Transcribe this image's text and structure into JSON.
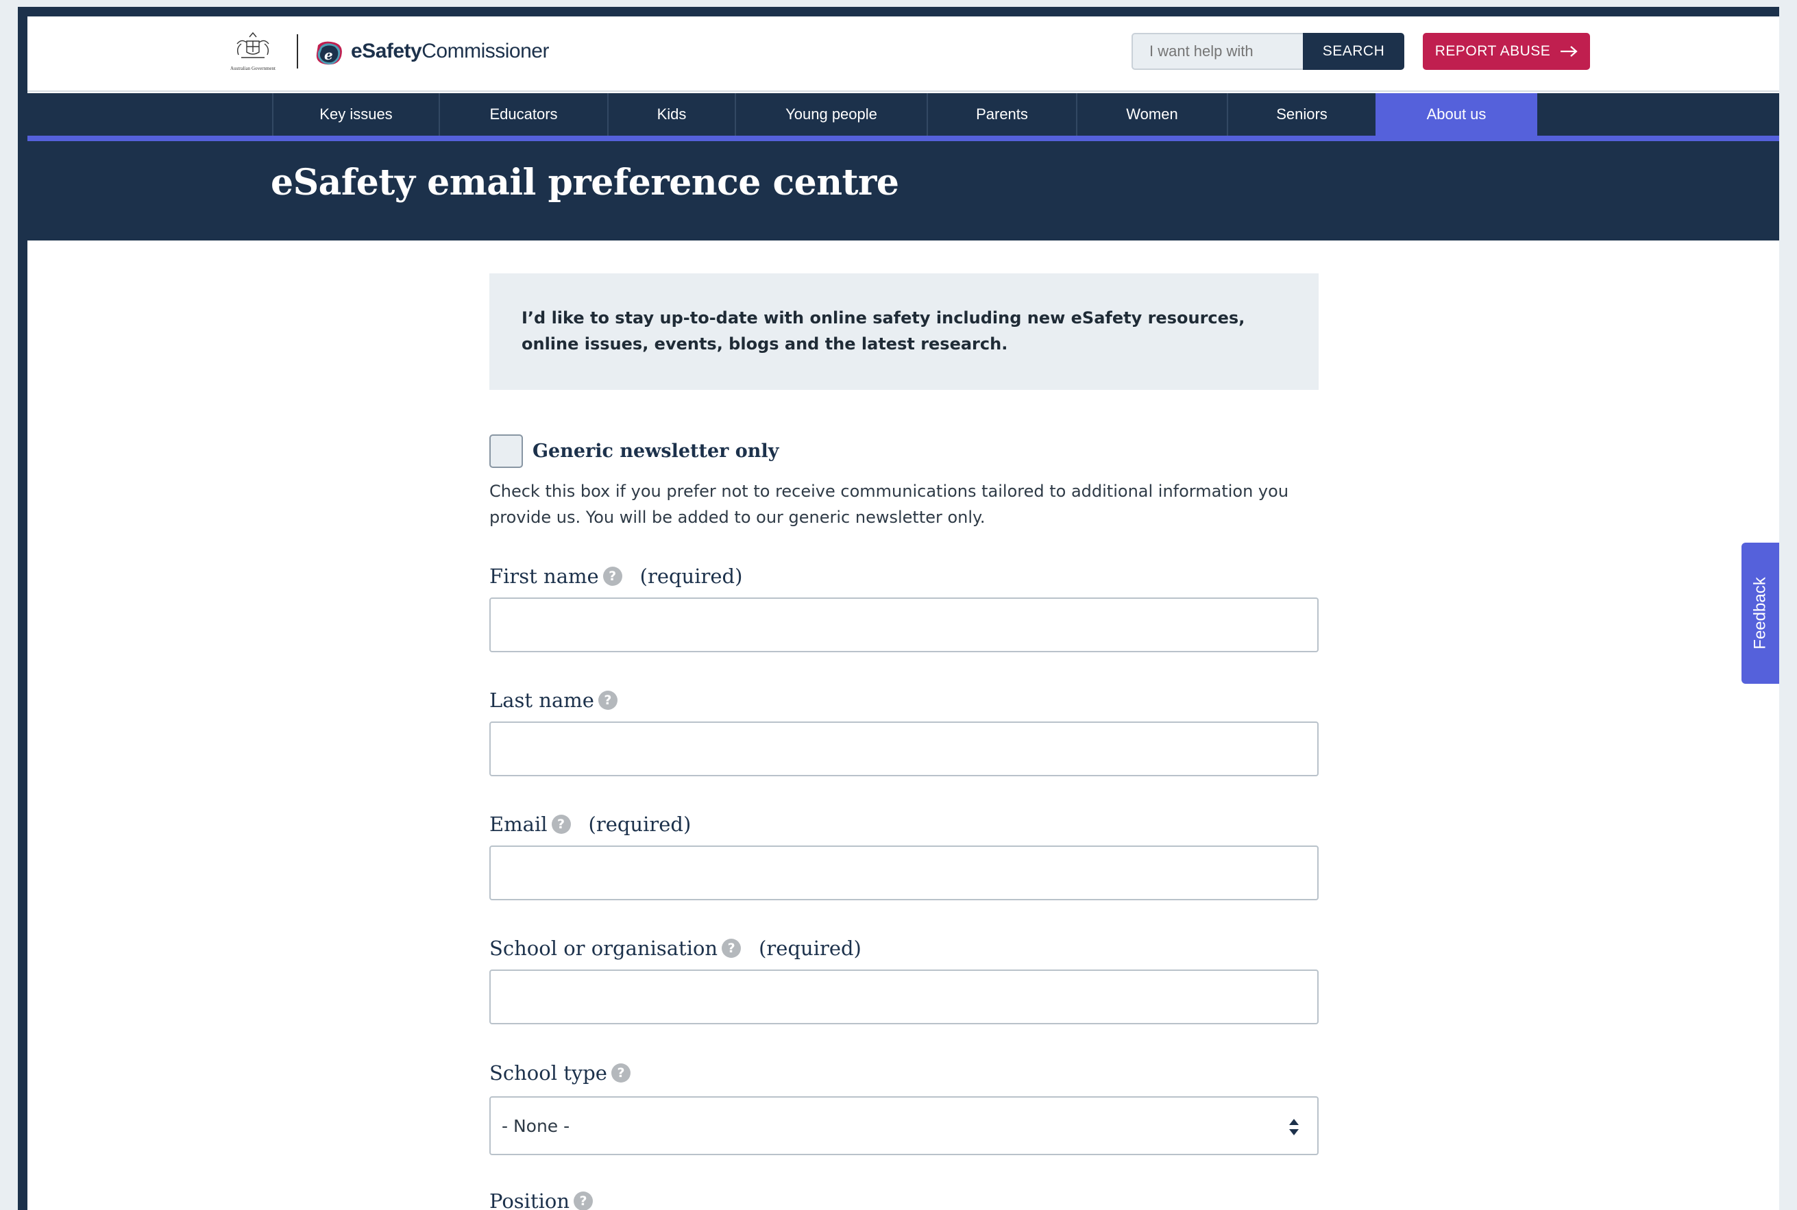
{
  "header": {
    "gov_text": "Australian Government",
    "brand_bold": "eSafety",
    "brand_thin": "Commissioner",
    "search_placeholder": "I want help with",
    "search_label": "SEARCH",
    "report_label": "REPORT ABUSE"
  },
  "nav": {
    "items": [
      {
        "label": "Key issues"
      },
      {
        "label": "Educators"
      },
      {
        "label": "Kids"
      },
      {
        "label": "Young people"
      },
      {
        "label": "Parents"
      },
      {
        "label": "Women"
      },
      {
        "label": "Seniors"
      },
      {
        "label": "About us",
        "active": true
      }
    ]
  },
  "page_title": "eSafety email preference centre",
  "intro_text": "I’d like to stay up-to-date with online safety including new eSafety resources, online issues, events, blogs and the latest research.",
  "generic_newsletter": {
    "label": "Generic newsletter only",
    "checked": false,
    "help": "Check this box if you prefer not to receive communications tailored to additional information you provide us. You will be added to our generic newsletter only."
  },
  "fields": {
    "first_name": {
      "label": "First name",
      "required": "(required)",
      "value": ""
    },
    "last_name": {
      "label": "Last name",
      "value": ""
    },
    "email": {
      "label": "Email",
      "required": "(required)",
      "value": ""
    },
    "school": {
      "label": "School or organisation",
      "required": "(required)",
      "value": ""
    },
    "school_type": {
      "label": "School type",
      "selected": "- None -"
    },
    "position": {
      "label": "Position"
    }
  },
  "help_glyph": "?",
  "feedback_label": "Feedback",
  "colors": {
    "navy": "#1c314b",
    "accent": "#5561db",
    "report": "#c01f4f",
    "panel": "#e9eef2"
  }
}
